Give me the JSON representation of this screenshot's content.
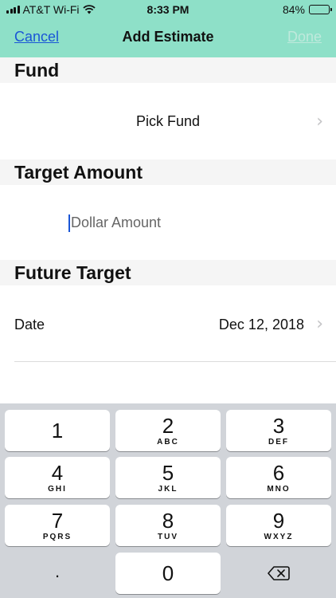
{
  "status_bar": {
    "carrier": "AT&T Wi-Fi",
    "time": "8:33 PM",
    "battery": "84%",
    "battery_level": 0.84
  },
  "nav": {
    "cancel": "Cancel",
    "title": "Add Estimate",
    "done": "Done"
  },
  "sections": {
    "fund": {
      "header": "Fund",
      "pick_label": "Pick Fund"
    },
    "target_amount": {
      "header": "Target Amount",
      "placeholder": "Dollar Amount"
    },
    "future_target": {
      "header": "Future Target",
      "date_label": "Date",
      "date_value": "Dec 12, 2018"
    }
  },
  "keypad": {
    "keys": [
      {
        "num": "1",
        "letters": ""
      },
      {
        "num": "2",
        "letters": "ABC"
      },
      {
        "num": "3",
        "letters": "DEF"
      },
      {
        "num": "4",
        "letters": "GHI"
      },
      {
        "num": "5",
        "letters": "JKL"
      },
      {
        "num": "6",
        "letters": "MNO"
      },
      {
        "num": "7",
        "letters": "PQRS"
      },
      {
        "num": "8",
        "letters": "TUV"
      },
      {
        "num": "9",
        "letters": "WXYZ"
      },
      {
        "num": ".",
        "letters": ""
      },
      {
        "num": "0",
        "letters": ""
      }
    ]
  },
  "icons": {
    "wifi": "wifi-icon",
    "signal": "signal-icon",
    "battery": "battery-icon",
    "chevron": "chevron-right-icon",
    "backspace": "backspace-icon"
  },
  "colors": {
    "nav_background": "#8ee0c8",
    "link": "#1a56d6",
    "keypad_background": "#d1d4d9"
  }
}
